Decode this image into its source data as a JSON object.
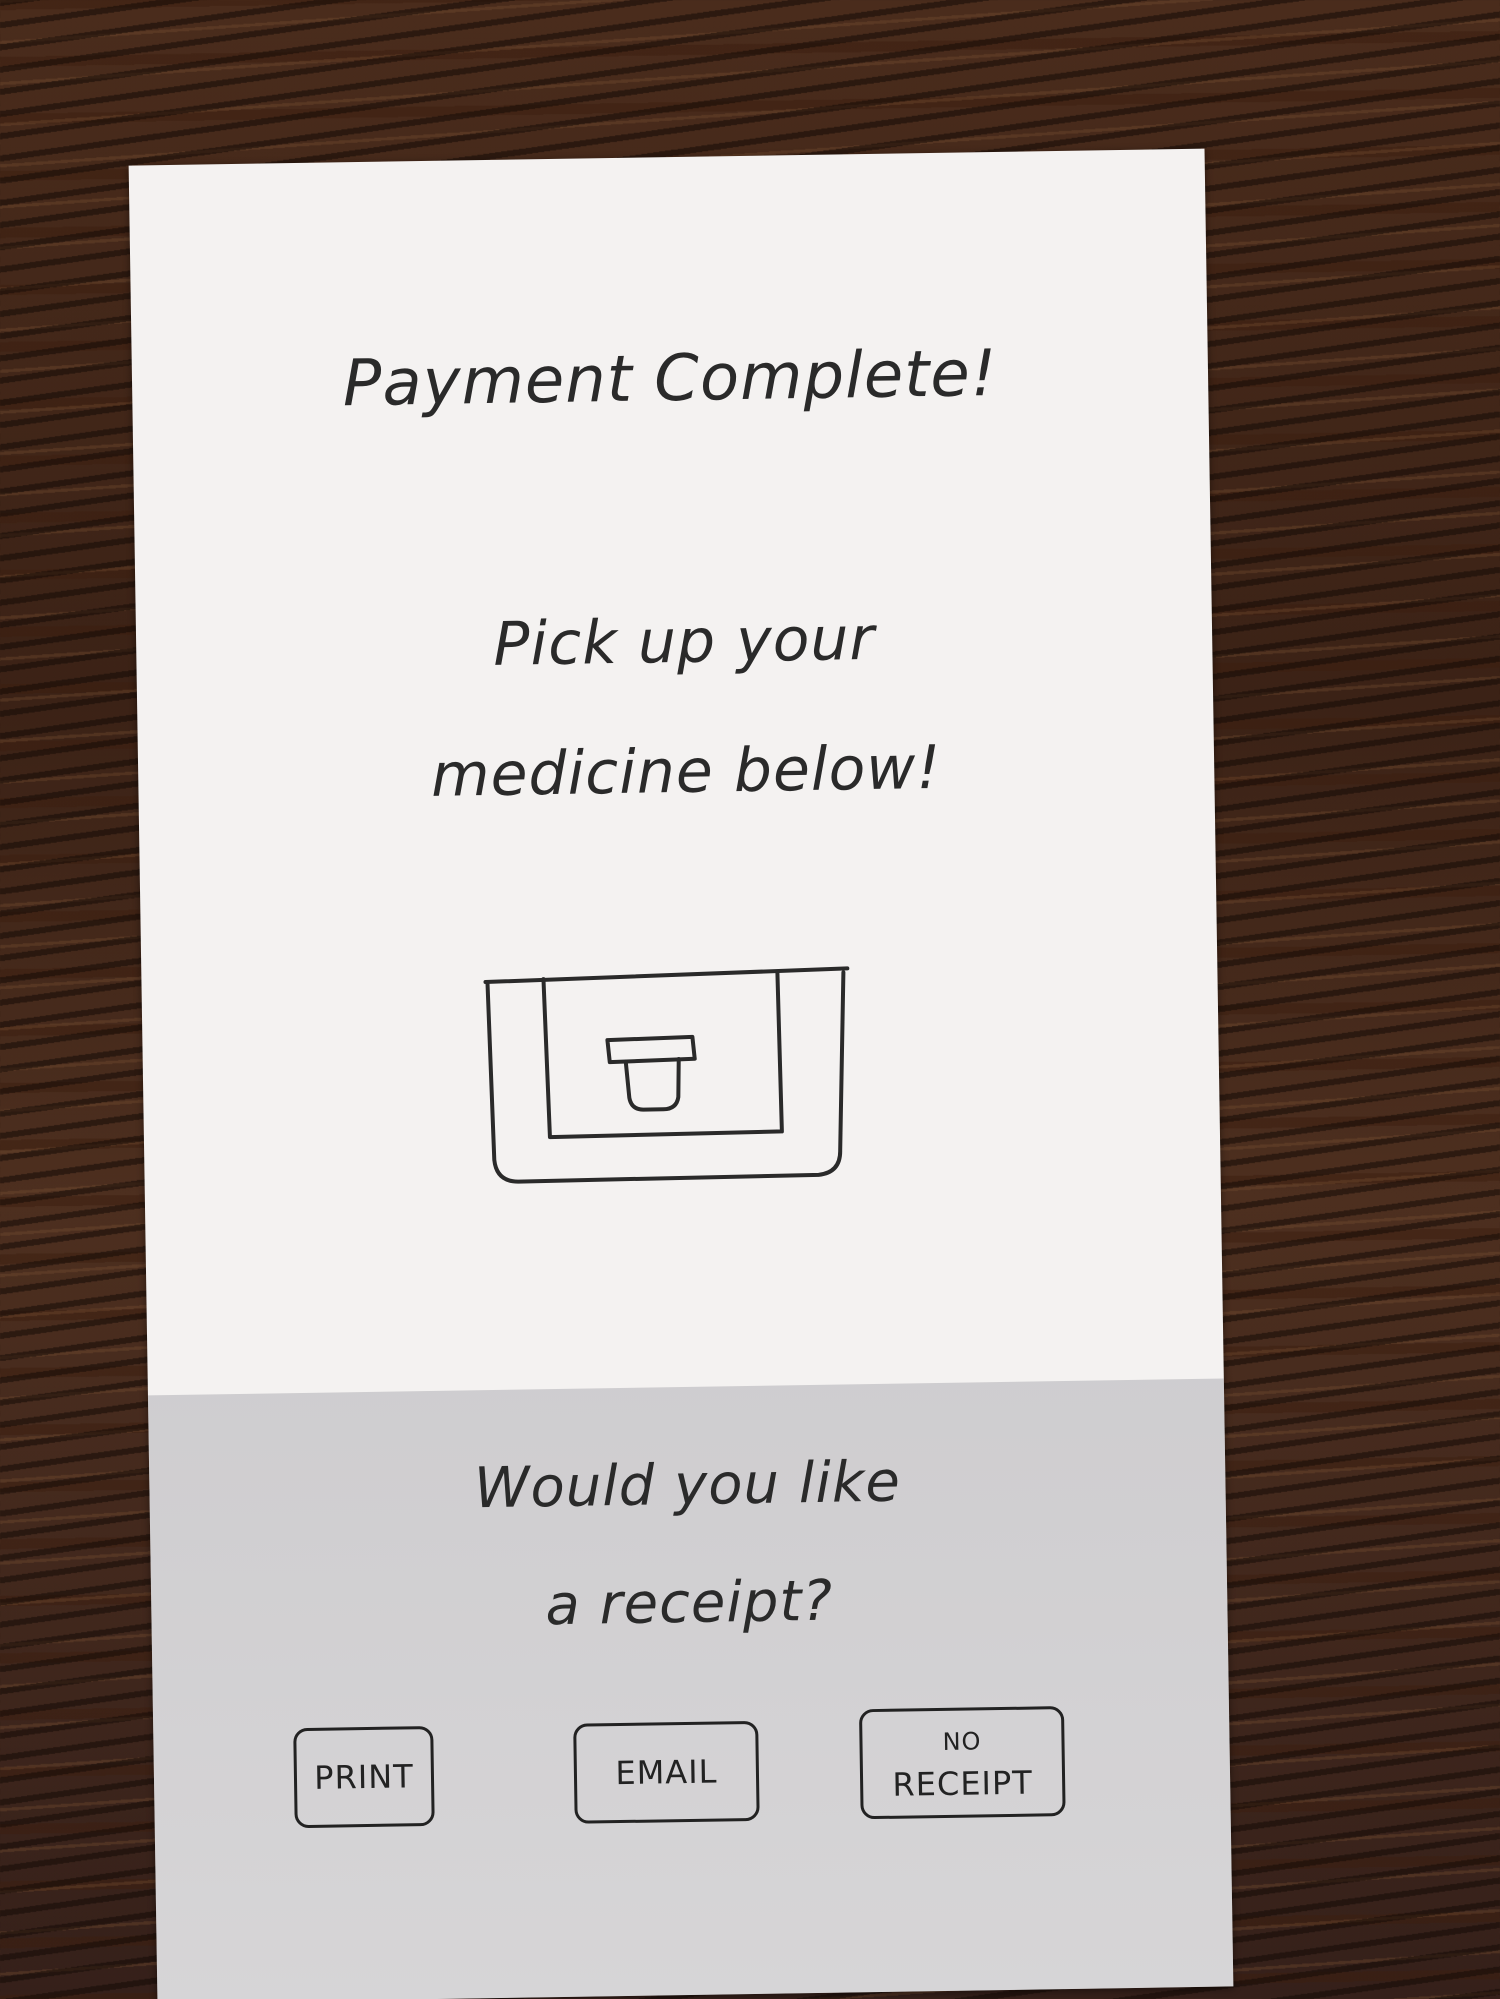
{
  "screen": {
    "title": "Payment Complete!",
    "instruction_line1": "Pick up your",
    "instruction_line2": "medicine below!",
    "question_line1": "Would you like",
    "question_line2": "a receipt?"
  },
  "buttons": {
    "print_label": "PRINT",
    "email_label": "EMAIL",
    "no_receipt_line1": "NO",
    "no_receipt_line2": "RECEIPT"
  },
  "icons": {
    "dispenser": "medicine-dispenser-icon"
  }
}
